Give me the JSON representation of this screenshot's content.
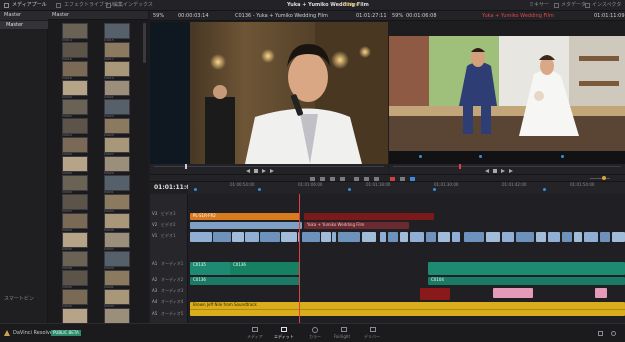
{
  "top_bar": {
    "media_pool": "メディアプール",
    "effects_library": "エフェクトライブラリ",
    "edit_index": "編集インデックス",
    "title": "Yuka + Yumiko Wedding Film",
    "edited": "Edited",
    "mixer": "ミキサー",
    "metadata": "メタデータ",
    "inspector": "インスペクタ"
  },
  "media_pool": {
    "bin_label": "Master",
    "bins": [
      "Master"
    ],
    "smart_bins_label": "スマートビン",
    "thumb_labels": [
      "C0014",
      "C0015",
      "C0016",
      "C0017",
      "C0018",
      "C0019",
      "C0020",
      "C0021",
      "C0022",
      "C0023",
      "C0024",
      "C0025",
      "C0026",
      "C0027",
      "C0028",
      "C0029",
      "C0030",
      "C0031",
      "C0032",
      "C0033",
      "C0034",
      "C0035",
      "C0036",
      "C0037",
      "C0038",
      "C0039",
      "C0040",
      "C0041",
      "C0042",
      "C0043",
      "C0044",
      "C0045"
    ]
  },
  "source_viewer": {
    "zoom": "59%",
    "timecode": "00:00:03:14",
    "clip_name": "C0136 - Yuka + Yumiko Wedding Film",
    "end_timecode": "01:01:27:11"
  },
  "timeline_viewer": {
    "zoom": "59%",
    "timecode": "00:01:06:08",
    "timeline_name": "Yuka + Yumiko Wedding Film",
    "current_timecode": "01:01:11:09"
  },
  "timeline": {
    "timecode": "01:01:11:09",
    "ruler_labels": [
      "01:00:54:00",
      "01:01:06:00",
      "01:01:18:00",
      "01:01:30:00",
      "01:01:42:00",
      "01:01:54:00"
    ],
    "tracks": [
      {
        "id": "V3",
        "name": "ビデオ3"
      },
      {
        "id": "V2",
        "name": "ビデオ2"
      },
      {
        "id": "V1",
        "name": "ビデオ1"
      },
      {
        "id": "A1",
        "name": "オーディオ1"
      },
      {
        "id": "A2",
        "name": "オーディオ2"
      },
      {
        "id": "A3",
        "name": "オーディオ3"
      },
      {
        "id": "A4",
        "name": "オーディオ4"
      },
      {
        "id": "A5",
        "name": "オーディオ5"
      }
    ],
    "clip_v2_title": "Yuka + Yumiko Wedding Film",
    "clip_v3_title": "PL-S1R-FR2",
    "clip_a1_labels": [
      "C0135",
      "C0136"
    ],
    "clip_a2_labels": [
      "C0136",
      "C0104"
    ],
    "clip_a5_label": "Brown Jeff Nile from Soundtrack"
  },
  "bottom_bar": {
    "app_name": "DaVinci Resolve 14",
    "badge": "PUBLIC BETA",
    "pages": [
      "メディア",
      "エディット",
      "カラー",
      "Fairlight",
      "デリバー"
    ],
    "active_page": "エディット"
  }
}
